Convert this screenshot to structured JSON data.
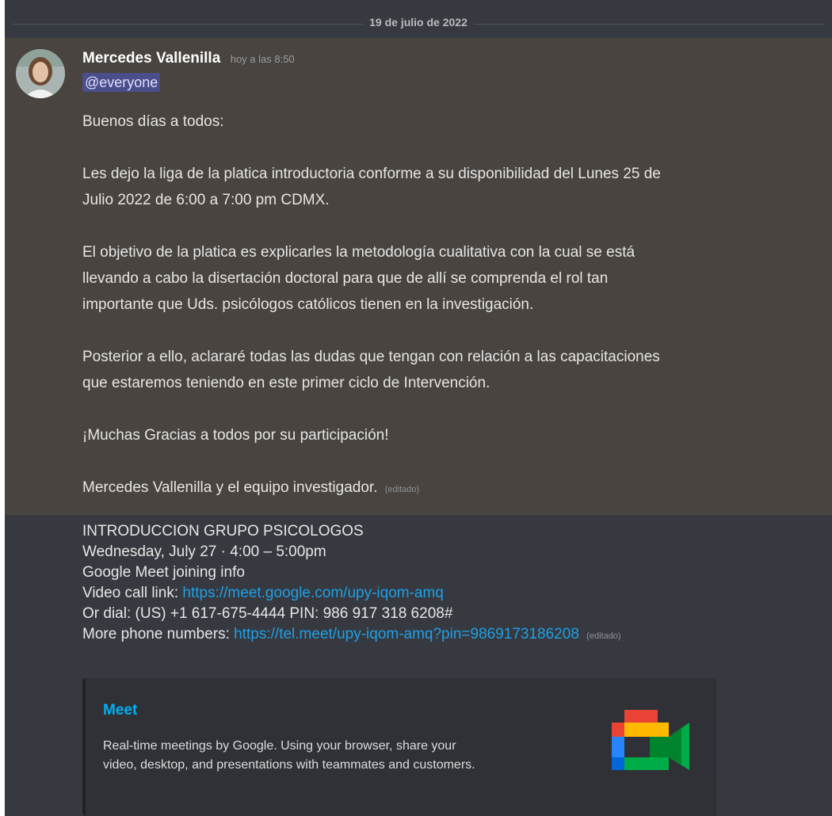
{
  "date_divider": "19 de julio de 2022",
  "message": {
    "author": "Mercedes Vallenilla",
    "timestamp": "hoy a las 8:50",
    "mention": "@everyone",
    "paragraphs": [
      [
        "Buenos días a todos:"
      ],
      [
        "Les dejo la liga de la platica introductoria conforme a su disponibilidad del Lunes 25 de",
        "Julio 2022 de 6:00 a 7:00 pm CDMX."
      ],
      [
        "El objetivo de la platica es explicarles la metodología cualitativa con la cual se está",
        "llevando a cabo la disertación doctoral para que de allí se comprenda el rol tan",
        "importante que Uds. psicólogos católicos tienen en la investigación."
      ],
      [
        "Posterior a ello, aclararé todas las dudas que tengan con relación a las capacitaciones",
        "que estaremos teniendo en este primer ciclo de Intervención."
      ],
      [
        "¡Muchas Gracias a todos por su participación!"
      ]
    ],
    "signature": "Mercedes Vallenilla y el equipo investigador.",
    "edited_label": "(editado)"
  },
  "followup": {
    "line1": "INTRODUCCION GRUPO PSICOLOGOS",
    "line2": "Wednesday, July 27 · 4:00 – 5:00pm",
    "line3": "Google Meet joining info",
    "video_label": "Video call link: ",
    "video_link": "https://meet.google.com/upy-iqom-amq",
    "line5": "Or dial: (US) +1 617-675-4444 PIN: 986 917 318 6208#",
    "phones_label": "More phone numbers: ",
    "phones_link": "https://tel.meet/upy-iqom-amq?pin=9869173186208",
    "edited_label": "(editado)"
  },
  "embed": {
    "title": "Meet",
    "description_lines": [
      "Real-time meetings by Google. Using your browser, share your",
      "video, desktop, and presentations with teammates and customers."
    ],
    "thumbnail_icon": "google-meet-icon"
  },
  "colors": {
    "background": "#36393f",
    "highlight": "#49443f",
    "link": "#1ea0e6",
    "mention_bg": "#4a4e8a",
    "embed_title": "#00b0f4"
  }
}
